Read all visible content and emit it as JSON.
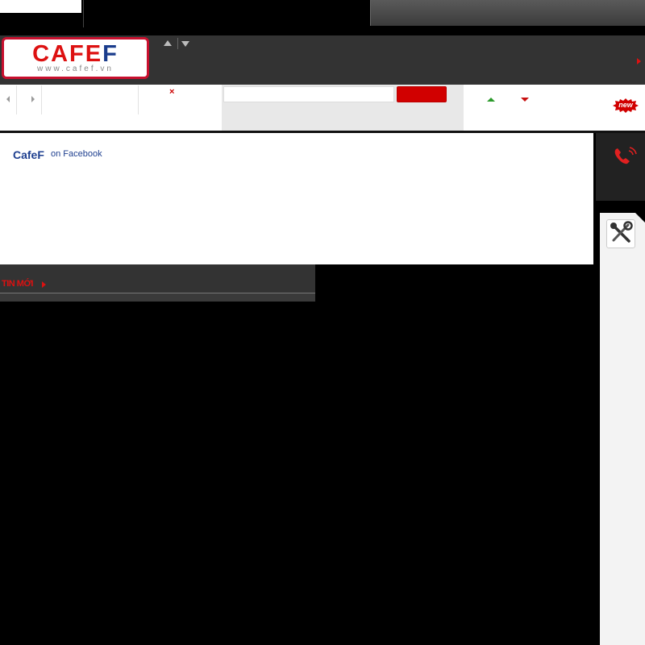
{
  "header": {
    "logo_text": "CAFEF",
    "logo_url": "www.cafef.vn"
  },
  "toolbar": {
    "close_symbol": "×",
    "search_placeholder": "",
    "new_badge": "new"
  },
  "facebook": {
    "brand": "CafeF",
    "suffix": "on Facebook"
  },
  "news": {
    "title": "TIN MỚI"
  },
  "colors": {
    "brand_red": "#d10000",
    "brand_blue": "#1e3f8f",
    "up_green": "#2a9a2a",
    "dark_bar": "#333333"
  },
  "icons": [
    "arrow-up-icon",
    "arrow-down-icon",
    "close-icon",
    "phone-icon",
    "tools-icon",
    "new-badge-icon"
  ]
}
